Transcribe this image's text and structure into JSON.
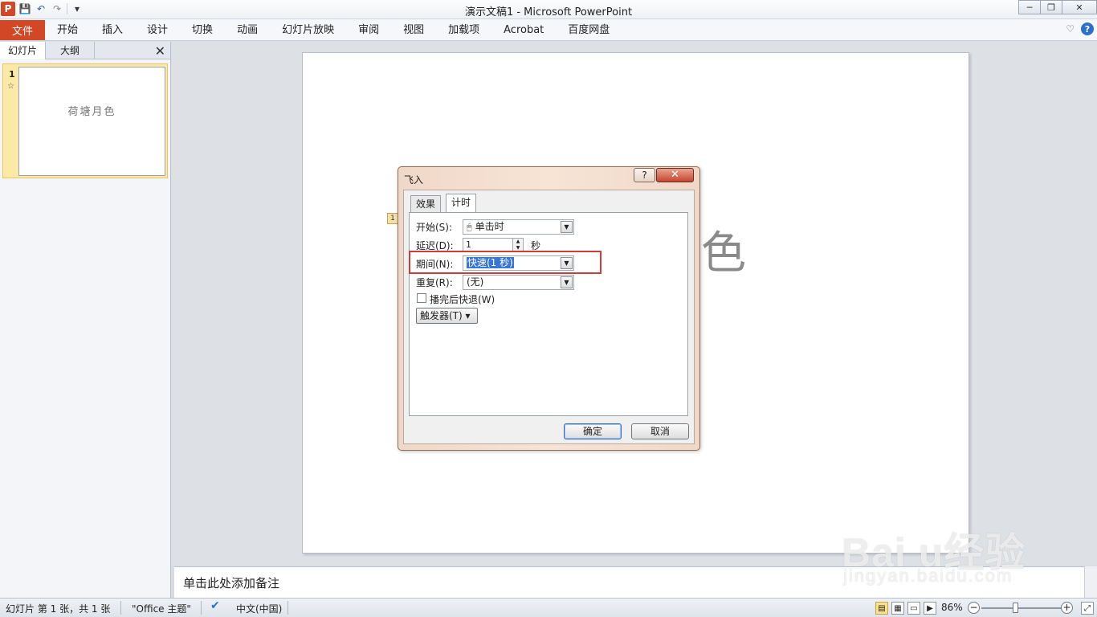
{
  "window": {
    "title": "演示文稿1 - Microsoft PowerPoint",
    "minimize": "─",
    "restore": "❐",
    "close": "✕"
  },
  "qat": {
    "logo": "P",
    "save_icon": "💾",
    "undo_icon": "↶",
    "redo_icon": "↷",
    "customize_icon": "▾"
  },
  "ribbon": {
    "file_label": "文件",
    "tabs": [
      "开始",
      "插入",
      "设计",
      "切换",
      "动画",
      "幻灯片放映",
      "审阅",
      "视图",
      "加载项",
      "Acrobat",
      "百度网盘"
    ],
    "collapse_icon": "♡",
    "help_icon": "?"
  },
  "left_panel": {
    "tabs": [
      "幻灯片",
      "大纲"
    ],
    "close_icon": "✕",
    "slide_number": "1",
    "slide_star": "☆",
    "thumbnail_text": "荷塘月色"
  },
  "slide": {
    "visible_char": "色",
    "anim_tag": "1"
  },
  "dialog": {
    "title": "飞入",
    "help_label": "?",
    "close_label": "✕",
    "tabs": [
      "效果",
      "计时"
    ],
    "start_label": "开始(S):",
    "start_value": "单击时",
    "delay_label": "延迟(D):",
    "delay_value": "1",
    "delay_unit": "秒",
    "duration_label": "期间(N):",
    "duration_value": "快速(1 秒)",
    "repeat_label": "重复(R):",
    "repeat_value": "(无)",
    "rewind_label": "播完后快退(W)",
    "rewind_checked": false,
    "trigger_label": "触发器(T) ▾",
    "ok_label": "确定",
    "cancel_label": "取消"
  },
  "notes": {
    "placeholder": "单击此处添加备注"
  },
  "statusbar": {
    "slide_info": "幻灯片 第 1 张，共 1 张",
    "theme": "\"Office 主题\"",
    "language": "中文(中国)",
    "zoom": "86%",
    "zoom_level_percent": 86
  },
  "watermark": {
    "brand": "Bai  u经验",
    "url": "jingyan.baidu.com"
  }
}
